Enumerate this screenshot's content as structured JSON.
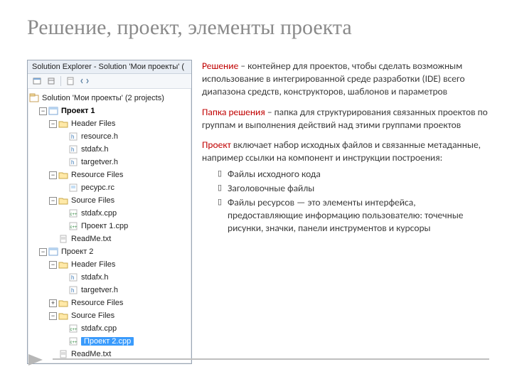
{
  "slide": {
    "title": "Решение, проект, элементы проекта"
  },
  "explorer": {
    "title": "Solution Explorer - Solution 'Мои проекты' (",
    "solution_label": "Solution 'Мои проекты' (2 projects)",
    "projects": [
      {
        "name": "Проект 1",
        "header_files_label": "Header Files",
        "headers": [
          "resource.h",
          "stdafx.h",
          "targetver.h"
        ],
        "resource_files_label": "Resource Files",
        "resources": [
          "ресурс.rc"
        ],
        "source_files_label": "Source Files",
        "sources": [
          "stdafx.cpp",
          "Проект 1.cpp"
        ],
        "readme": "ReadMe.txt"
      },
      {
        "name": "Проект 2",
        "header_files_label": "Header Files",
        "headers": [
          "stdafx.h",
          "targetver.h"
        ],
        "resource_files_label": "Resource Files",
        "source_files_label": "Source Files",
        "sources": [
          "stdafx.cpp",
          "Проект 2.cpp"
        ],
        "readme": "ReadMe.txt",
        "selected": "Проект 2.cpp"
      }
    ]
  },
  "definitions": {
    "d1_term": "Решение",
    "d1_body": "– контейнер для проектов, чтобы сделать возможным использование в интегрированной среде разработки (IDE) всего диапазона средств, конструкторов, шаблонов и параметров",
    "d2_term": "Папка решения",
    "d2_body": "– папка для структурирования связанных проектов по группам и выполнения действий над этими группами проектов",
    "d3_term": "Проект",
    "d3_body": "включает набор исходных файлов и связанные метаданные, например ссылки на компонент и инструкции построения:",
    "bullets": [
      "Файлы исходного кода",
      "Заголовочные файлы",
      "Файлы ресурсов — это элементы интерфейса, предоставляющие информацию пользователю: точечные рисунки, значки, панели инструментов и курсоры"
    ]
  }
}
